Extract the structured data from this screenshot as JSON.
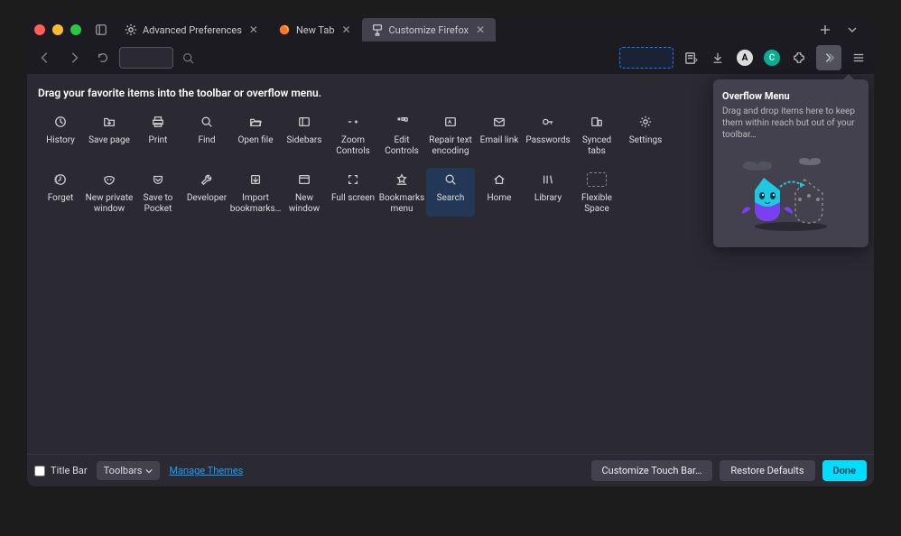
{
  "tabs": [
    {
      "label": "Advanced Preferences",
      "icon": "gear"
    },
    {
      "label": "New Tab",
      "icon": "firefox"
    },
    {
      "label": "Customize Firefox",
      "icon": "paint",
      "active": true
    }
  ],
  "instruction": "Drag your favorite items into the toolbar or overflow menu.",
  "items_row1": [
    {
      "key": "history",
      "label": "History",
      "icon": "history"
    },
    {
      "key": "save-page",
      "label": "Save page",
      "icon": "folder-down"
    },
    {
      "key": "print",
      "label": "Print",
      "icon": "printer"
    },
    {
      "key": "find",
      "label": "Find",
      "icon": "search"
    },
    {
      "key": "open-file",
      "label": "Open file",
      "icon": "folder-open"
    },
    {
      "key": "sidebars",
      "label": "Sidebars",
      "icon": "sidebar"
    },
    {
      "key": "zoom",
      "label": "Zoom Controls",
      "icon": "zoom"
    },
    {
      "key": "edit-controls",
      "label": "Edit Controls",
      "icon": "edit-ctrl"
    },
    {
      "key": "repair-text",
      "label": "Repair text encoding",
      "icon": "repair"
    },
    {
      "key": "email-link",
      "label": "Email link",
      "icon": "mail"
    },
    {
      "key": "passwords",
      "label": "Passwords",
      "icon": "key"
    },
    {
      "key": "synced-tabs",
      "label": "Synced tabs",
      "icon": "synced"
    },
    {
      "key": "settings",
      "label": "Settings",
      "icon": "gear"
    }
  ],
  "items_row2": [
    {
      "key": "forget",
      "label": "Forget",
      "icon": "forget"
    },
    {
      "key": "new-private",
      "label": "New private window",
      "icon": "mask"
    },
    {
      "key": "save-pocket",
      "label": "Save to Pocket",
      "icon": "pocket"
    },
    {
      "key": "developer",
      "label": "Developer",
      "icon": "wrench"
    },
    {
      "key": "import-bookmarks",
      "label": "Import bookmarks…",
      "icon": "import"
    },
    {
      "key": "new-window",
      "label": "New window",
      "icon": "window"
    },
    {
      "key": "full-screen",
      "label": "Full screen",
      "icon": "fullscreen"
    },
    {
      "key": "bookmarks-menu",
      "label": "Bookmarks menu",
      "icon": "bookmarks"
    },
    {
      "key": "search-item",
      "label": "Search",
      "icon": "search",
      "highlight": true
    },
    {
      "key": "home",
      "label": "Home",
      "icon": "home"
    },
    {
      "key": "library",
      "label": "Library",
      "icon": "library"
    },
    {
      "key": "flexible-space",
      "label": "Flexible Space",
      "icon": "flexspace"
    }
  ],
  "overflow": {
    "title": "Overflow Menu",
    "desc": "Drag and drop items here to keep them within reach but out of your toolbar…"
  },
  "footer": {
    "titlebar_label": "Title Bar",
    "toolbars_label": "Toolbars",
    "manage_themes": "Manage Themes",
    "customize_touch": "Customize Touch Bar…",
    "restore_defaults": "Restore Defaults",
    "done": "Done"
  },
  "navbar_icons": {
    "account_letter": "A",
    "profile_letter": "C"
  }
}
